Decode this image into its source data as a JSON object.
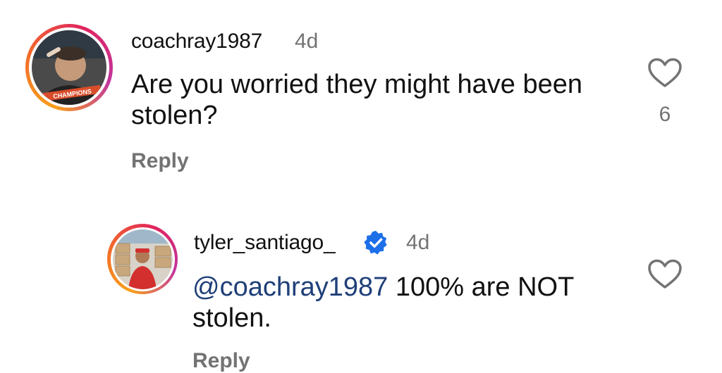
{
  "comments": [
    {
      "username": "coachray1987",
      "time": "4d",
      "text_lines": [
        "Are you worried they might have been",
        "stolen?"
      ],
      "reply_label": "Reply",
      "like_count": "6",
      "verified": false,
      "avatar_icon": "user-avatar-icon"
    },
    {
      "username": "tyler_santiago_",
      "time": "4d",
      "mention": "@coachray1987",
      "text_after_mention": " 100% are NOT",
      "text_line2": "stolen.",
      "reply_label": "Reply",
      "verified": true,
      "avatar_icon": "user-avatar-icon"
    }
  ],
  "colors": {
    "text": "#111111",
    "secondary": "#737373",
    "mention": "#1f3f78",
    "verified_badge": "#1d6fe8"
  }
}
